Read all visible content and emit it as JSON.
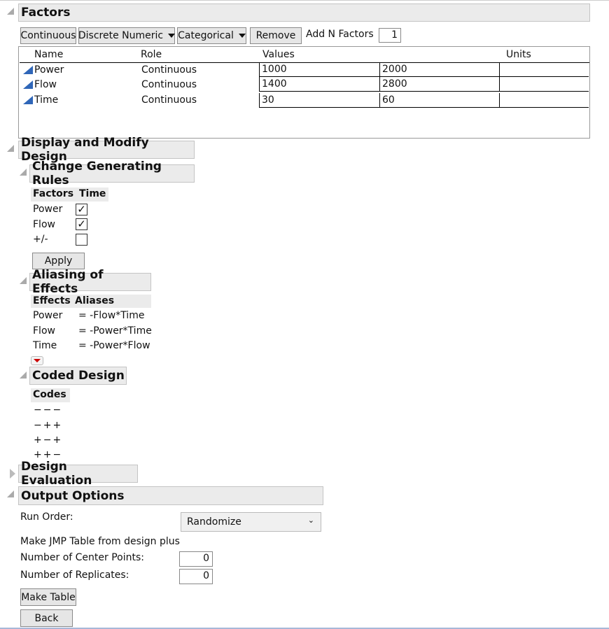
{
  "factors": {
    "title": "Factors",
    "buttons": {
      "continuous": "Continuous",
      "discrete_numeric": "Discrete Numeric",
      "categorical": "Categorical",
      "remove": "Remove"
    },
    "add_n_label": "Add N Factors",
    "add_n_value": "1",
    "columns": [
      "Name",
      "Role",
      "Values",
      "Units"
    ],
    "rows": [
      {
        "name": "Power",
        "role": "Continuous",
        "low": "1000",
        "high": "2000",
        "units": ""
      },
      {
        "name": "Flow",
        "role": "Continuous",
        "low": "1400",
        "high": "2800",
        "units": ""
      },
      {
        "name": "Time",
        "role": "Continuous",
        "low": "30",
        "high": "60",
        "units": ""
      }
    ]
  },
  "display_modify": {
    "title": "Display and Modify Design"
  },
  "generating_rules": {
    "title": "Change Generating Rules",
    "columns": [
      "Factors",
      "Time"
    ],
    "rows": [
      {
        "label": "Power",
        "checked": true
      },
      {
        "label": "Flow",
        "checked": true
      },
      {
        "label": "+/-",
        "checked": false
      }
    ],
    "apply": "Apply"
  },
  "aliasing": {
    "title": "Aliasing of Effects",
    "columns": [
      "Effects",
      "Aliases"
    ],
    "rows": [
      {
        "effect": "Power",
        "alias": "= -Flow*Time"
      },
      {
        "effect": "Flow",
        "alias": "= -Power*Time"
      },
      {
        "effect": "Time",
        "alias": "= -Power*Flow"
      }
    ]
  },
  "coded_design": {
    "title": "Coded Design",
    "column": "Codes",
    "rows": [
      "−−−",
      "−++",
      "+−+",
      "++−"
    ]
  },
  "design_evaluation": {
    "title": "Design Evaluation"
  },
  "output_options": {
    "title": "Output Options",
    "run_order_label": "Run Order:",
    "run_order_value": "Randomize",
    "make_table_text": "Make JMP Table from design plus",
    "center_points_label": "Number of Center Points:",
    "center_points_value": "0",
    "replicates_label": "Number of Replicates:",
    "replicates_value": "0",
    "make_table": "Make Table",
    "back": "Back"
  }
}
